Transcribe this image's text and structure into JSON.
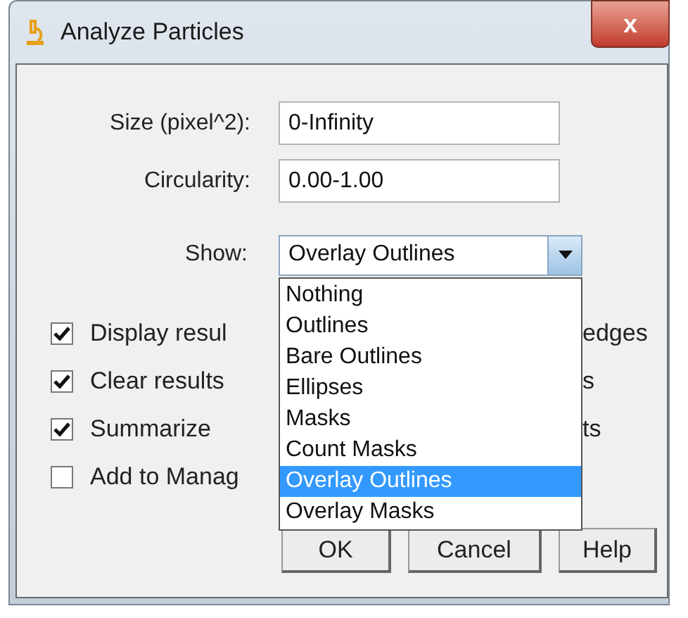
{
  "window": {
    "title": "Analyze Particles",
    "close": "x"
  },
  "fields": [
    {
      "label": "Size (pixel^2):",
      "value": "0-Infinity"
    },
    {
      "label": "Circularity:",
      "value": "0.00-1.00"
    }
  ],
  "show": {
    "label": "Show:",
    "value": "Overlay Outlines",
    "expanded": true,
    "options": [
      {
        "label": "Nothing",
        "selected": false
      },
      {
        "label": "Outlines",
        "selected": false
      },
      {
        "label": "Bare Outlines",
        "selected": false
      },
      {
        "label": "Ellipses",
        "selected": false
      },
      {
        "label": "Masks",
        "selected": false
      },
      {
        "label": "Count Masks",
        "selected": false
      },
      {
        "label": "Overlay Outlines",
        "selected": true
      },
      {
        "label": "Overlay Masks",
        "selected": false
      }
    ]
  },
  "checkboxes": [
    {
      "label": "Display resul",
      "checked": true,
      "right_text": "edges"
    },
    {
      "label": "Clear results",
      "checked": true,
      "right_text": "s"
    },
    {
      "label": "Summarize",
      "checked": true,
      "right_text": "ts"
    },
    {
      "label": "Add to Manag",
      "checked": false
    }
  ],
  "buttons": [
    "OK",
    "Cancel",
    "Help"
  ]
}
